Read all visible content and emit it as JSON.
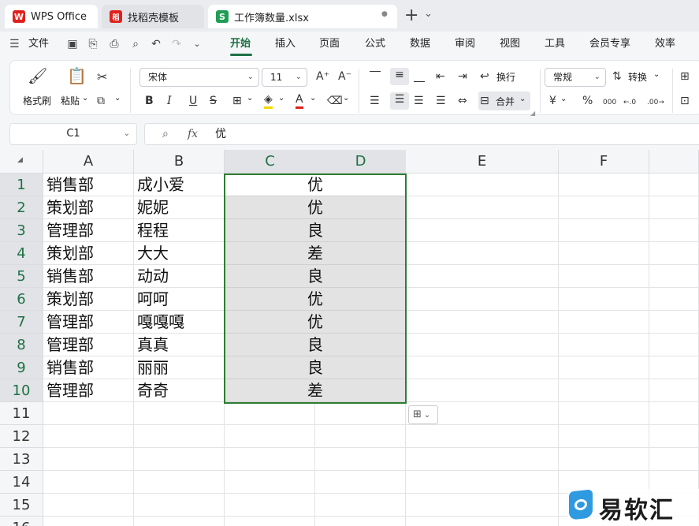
{
  "tabs": [
    {
      "label": "WPS Office",
      "icon": "W",
      "color": "#e0211d"
    },
    {
      "label": "找稻壳模板",
      "icon": "稻",
      "color": "#e0211d"
    },
    {
      "label": "工作簿数量.xlsx",
      "icon": "S",
      "color": "#1f9d55"
    }
  ],
  "tab_close": "●",
  "new_tab": "+",
  "tab_more": "⌄",
  "menu": {
    "file": "文件",
    "items": [
      "开始",
      "插入",
      "页面",
      "公式",
      "数据",
      "审阅",
      "视图",
      "工具",
      "会员专享",
      "效率"
    ],
    "active": "开始"
  },
  "ribbon": {
    "format_painter": "格式刷",
    "paste": "粘贴",
    "font_name": "宋体",
    "font_size": "11",
    "wrap": "换行",
    "merge": "合并",
    "number_format": "常规",
    "convert": "转换",
    "bold": "B",
    "italic": "I",
    "underline": "U",
    "strike": "S",
    "grow": "A⁺",
    "shrink": "A⁻",
    "currency": "¥",
    "percent": "%",
    "thousands": "000",
    "dec_inc": "←.0",
    "dec_dec": ".00→"
  },
  "formula_bar": {
    "cell": "C1",
    "fx": "fx",
    "value": "优"
  },
  "columns": [
    "A",
    "B",
    "C",
    "D",
    "E",
    "F"
  ],
  "rows": [
    "1",
    "2",
    "3",
    "4",
    "5",
    "6",
    "7",
    "8",
    "9",
    "10",
    "11",
    "12",
    "13",
    "14",
    "15",
    "16"
  ],
  "data": [
    {
      "a": "销售部",
      "b": "成小爱",
      "c": "优"
    },
    {
      "a": "策划部",
      "b": "妮妮",
      "c": "优"
    },
    {
      "a": "管理部",
      "b": "程程",
      "c": "良"
    },
    {
      "a": "策划部",
      "b": "大大",
      "c": "差"
    },
    {
      "a": "销售部",
      "b": "动动",
      "c": "良"
    },
    {
      "a": "策划部",
      "b": "呵呵",
      "c": "优"
    },
    {
      "a": "管理部",
      "b": "嘎嘎嘎",
      "c": "优"
    },
    {
      "a": "管理部",
      "b": "真真",
      "c": "良"
    },
    {
      "a": "销售部",
      "b": "丽丽",
      "c": "良"
    },
    {
      "a": "管理部",
      "b": "奇奇",
      "c": "差"
    }
  ],
  "watermark": "易软汇",
  "colors": {
    "accent": "#1e7145",
    "selection": "#2e7d32",
    "wps_red": "#e0211d",
    "excel_green": "#1f9d55"
  }
}
